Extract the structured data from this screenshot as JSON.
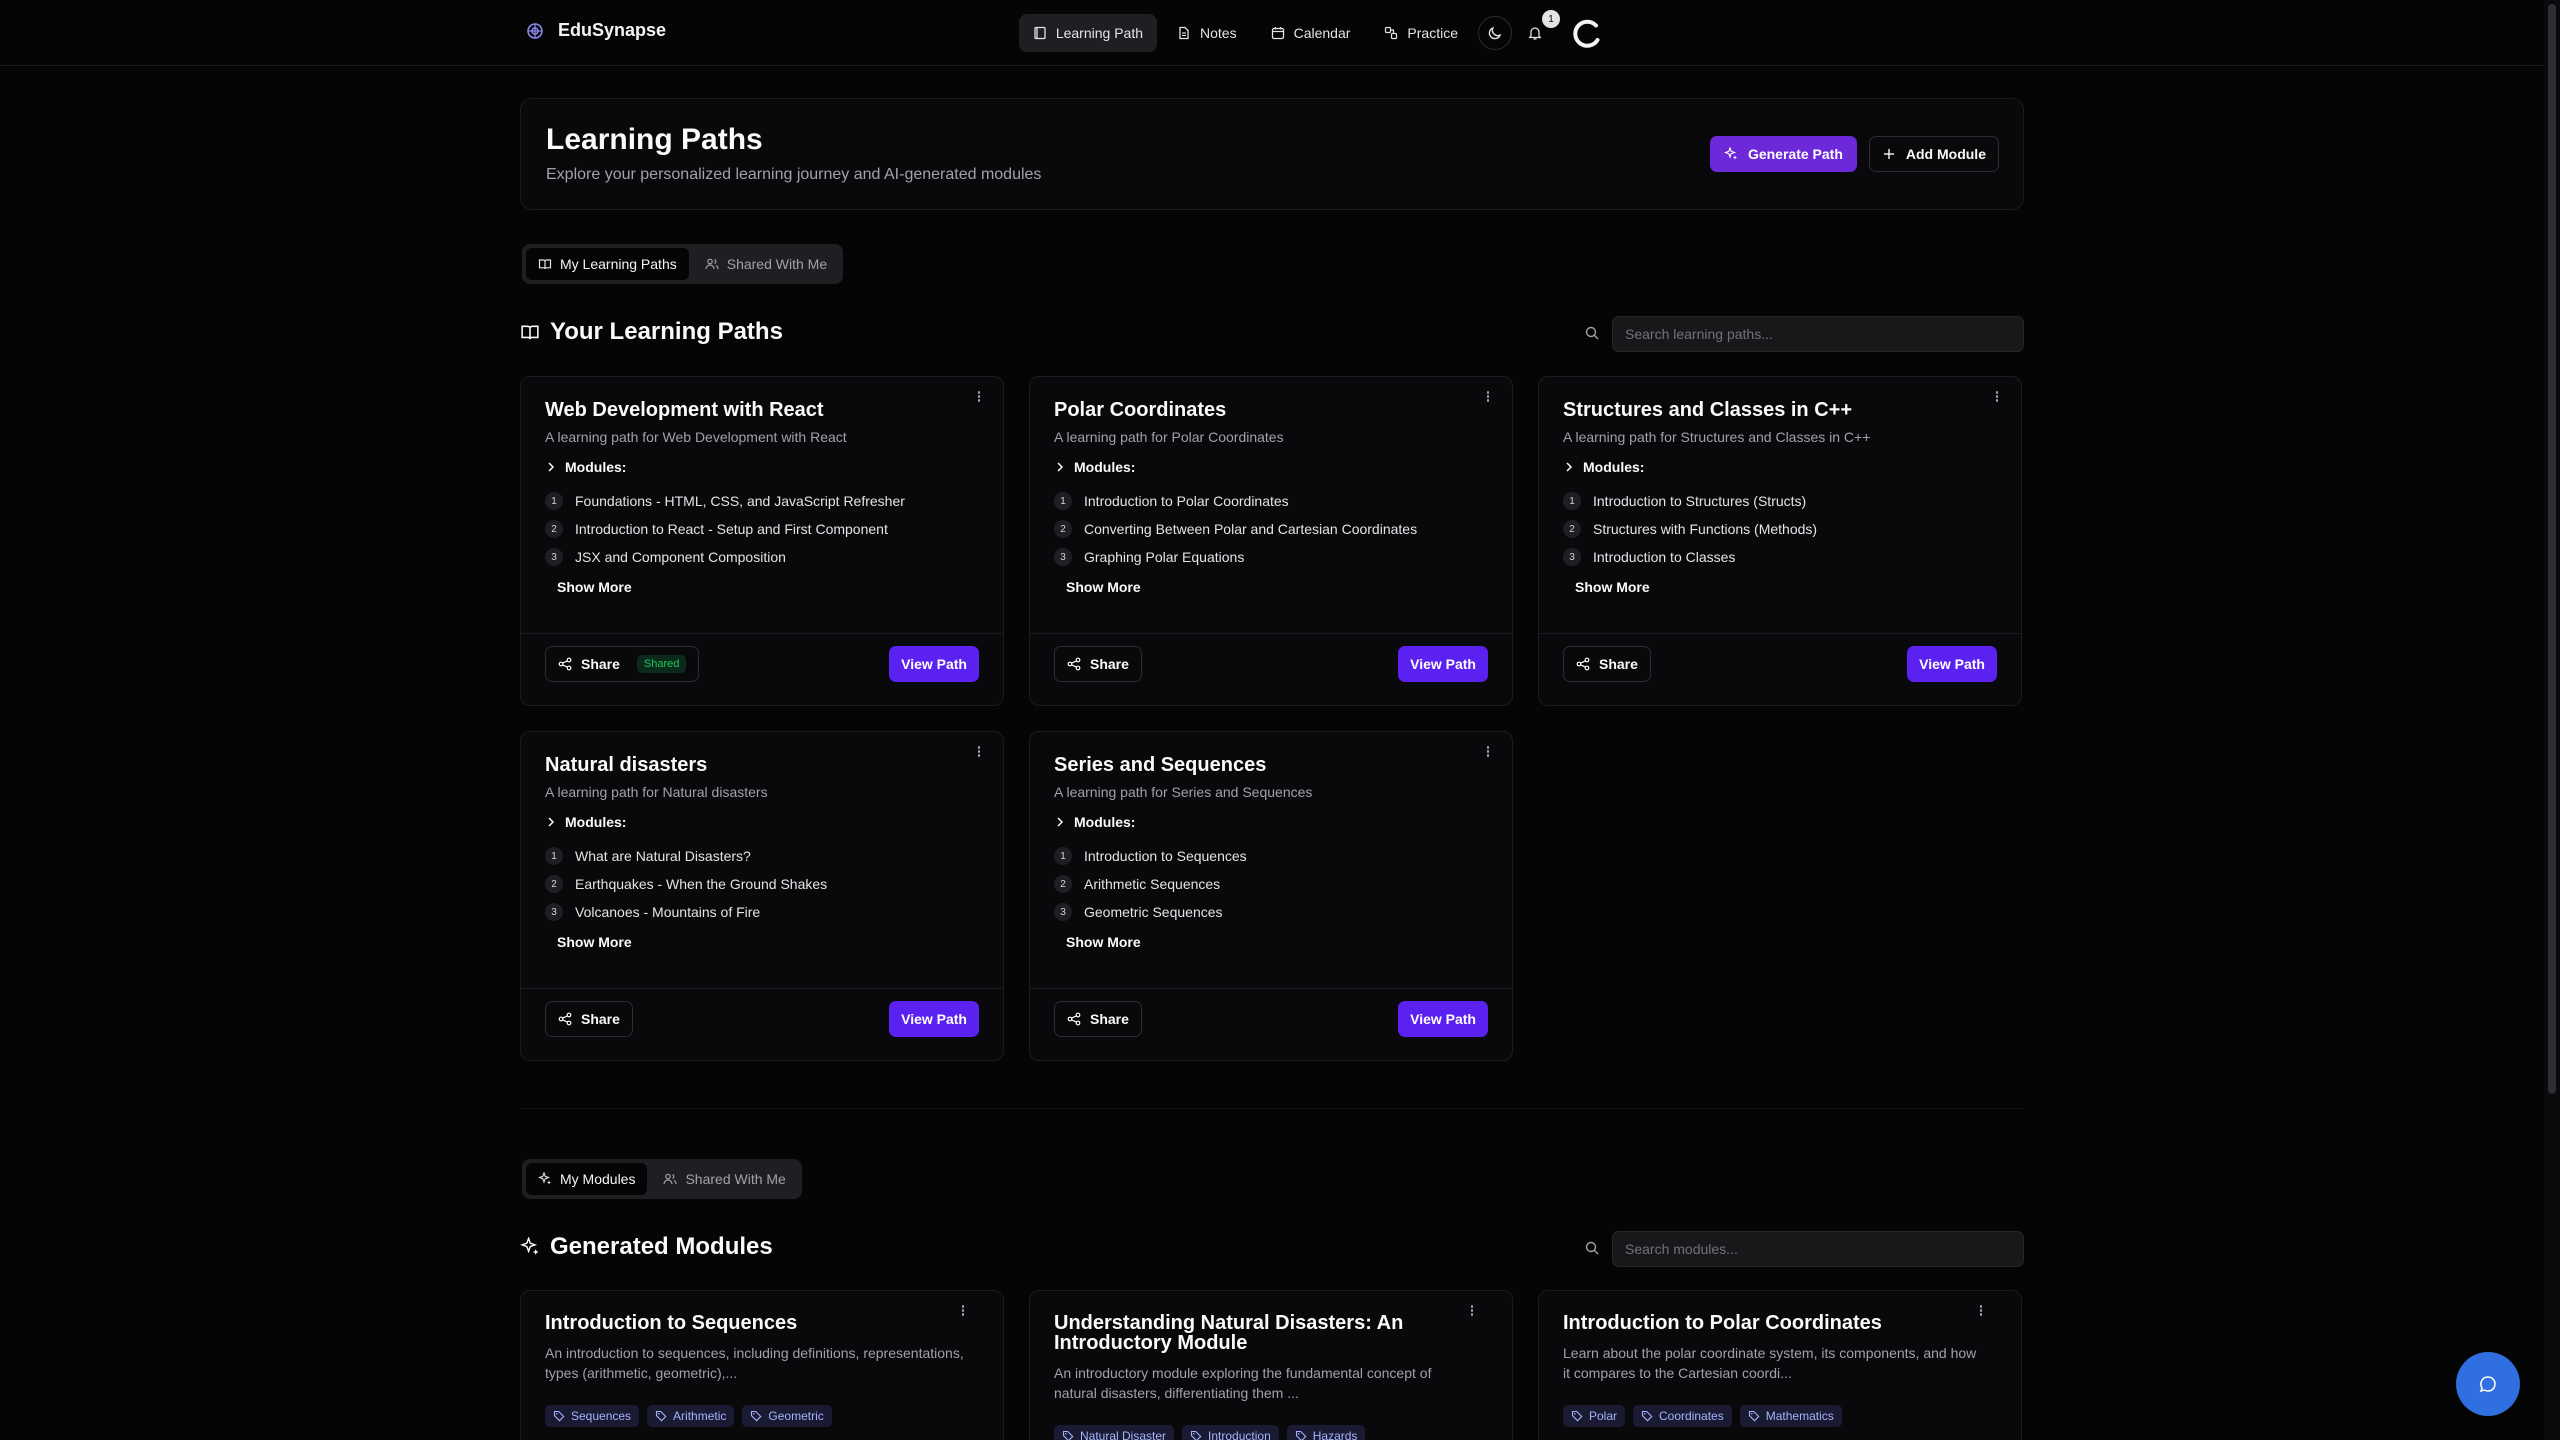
{
  "brand": {
    "name": "EduSynapse"
  },
  "nav": {
    "items": [
      {
        "label": "Learning Path",
        "icon": "book-icon",
        "active": true
      },
      {
        "label": "Notes",
        "icon": "file-text-icon"
      },
      {
        "label": "Calendar",
        "icon": "calendar-icon"
      },
      {
        "label": "Practice",
        "icon": "puzzle-icon"
      }
    ],
    "notification_count": "1"
  },
  "header": {
    "title": "Learning Paths",
    "subtitle": "Explore your personalized learning journey and AI-generated modules",
    "generate_label": "Generate Path",
    "add_label": "Add Module"
  },
  "path_tabs": [
    {
      "label": "My Learning Paths"
    },
    {
      "label": "Shared With Me"
    }
  ],
  "paths_section": {
    "title": "Your Learning Paths",
    "search_placeholder": "Search learning paths..."
  },
  "common": {
    "modules_label": "Modules:",
    "show_more": "Show More",
    "share": "Share",
    "view_path": "View Path",
    "shared_badge": "Shared"
  },
  "paths": [
    {
      "title": "Web Development with React",
      "desc": "A learning path for Web Development with React",
      "shared": true,
      "modules": [
        "Foundations - HTML, CSS, and JavaScript Refresher",
        "Introduction to React - Setup and First Component",
        "JSX and Component Composition"
      ]
    },
    {
      "title": "Polar Coordinates",
      "desc": "A learning path for Polar Coordinates",
      "modules": [
        "Introduction to Polar Coordinates",
        "Converting Between Polar and Cartesian Coordinates",
        "Graphing Polar Equations"
      ]
    },
    {
      "title": "Structures and Classes in C++",
      "desc": "A learning path for Structures and Classes in C++",
      "modules": [
        "Introduction to Structures (Structs)",
        "Structures with Functions (Methods)",
        "Introduction to Classes"
      ]
    },
    {
      "title": "Natural disasters",
      "desc": "A learning path for Natural disasters",
      "modules": [
        "What are Natural Disasters?",
        "Earthquakes - When the Ground Shakes",
        "Volcanoes - Mountains of Fire"
      ]
    },
    {
      "title": "Series and Sequences",
      "desc": "A learning path for Series and Sequences",
      "modules": [
        "Introduction to Sequences",
        "Arithmetic Sequences",
        "Geometric Sequences"
      ]
    }
  ],
  "module_tabs": [
    {
      "label": "My Modules"
    },
    {
      "label": "Shared With Me"
    }
  ],
  "modules_section": {
    "title": "Generated Modules",
    "search_placeholder": "Search modules..."
  },
  "generated_modules": [
    {
      "title": "Introduction to Sequences",
      "desc": "An introduction to sequences, including definitions, representations, types (arithmetic, geometric),...",
      "tags": [
        "Sequences",
        "Arithmetic",
        "Geometric"
      ]
    },
    {
      "title": "Understanding Natural Disasters: An Introductory Module",
      "desc": "An introductory module exploring the fundamental concept of natural disasters, differentiating them ...",
      "tags": [
        "Natural Disaster",
        "Introduction",
        "Hazards"
      ]
    },
    {
      "title": "Introduction to Polar Coordinates",
      "desc": "Learn about the polar coordinate system, its components, and how it compares to the Cartesian coordi...",
      "tags": [
        "Polar",
        "Coordinates",
        "Mathematics"
      ]
    }
  ]
}
